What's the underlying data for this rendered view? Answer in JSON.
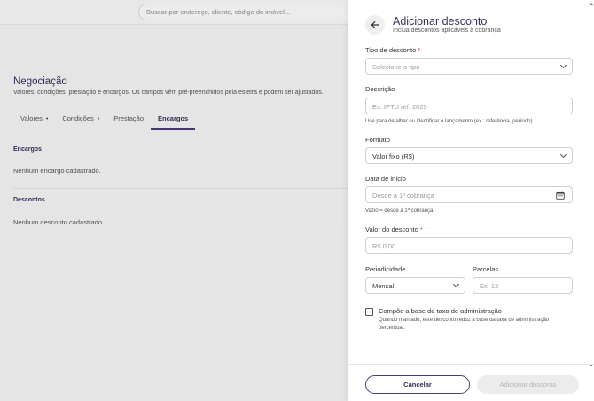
{
  "background": {
    "search_placeholder": "Buscar por endereço, cliente, código do imóvel...",
    "page_title": "Negociação",
    "page_subtitle": "Valores, condições, prestação e encargos. Os campos vêm pré-preenchidos pela esteira e podem ser ajustados.",
    "tabs": [
      {
        "label": "Valores",
        "marker": "•"
      },
      {
        "label": "Condições",
        "marker": "•"
      },
      {
        "label": "Prestação",
        "marker": ""
      },
      {
        "label": "Encargos",
        "marker": ""
      }
    ],
    "sections": {
      "encargos_title": "Encargos",
      "encargos_empty": "Nenhum encargo cadastrado.",
      "descontos_title": "Descontos",
      "descontos_empty": "Nenhum desconto cadastrado."
    }
  },
  "drawer": {
    "title": "Adicionar desconto",
    "subtitle": "Inclua descontos aplicáveis à cobrança",
    "tipo": {
      "label": "Tipo de desconto",
      "required": "*",
      "placeholder": "Selecione o tipo"
    },
    "descricao": {
      "label": "Descrição",
      "placeholder": "Ex: IPTU ref. 2025",
      "hint": "Use para detalhar ou identificar o lançamento (ex.: referência, período)."
    },
    "formato": {
      "label": "Formato",
      "value": "Valor fixo (R$)"
    },
    "data_inicio": {
      "label": "Data de início",
      "placeholder": "Desde a 1ª cobrança",
      "hint": "Vazio = desde a 1ª cobrança."
    },
    "valor": {
      "label": "Valor do desconto",
      "required": "*",
      "placeholder": "R$ 0,00"
    },
    "periodicidade": {
      "label": "Periodicidade",
      "value": "Mensal"
    },
    "parcelas": {
      "label": "Parcelas",
      "placeholder": "Ex: 12"
    },
    "checkbox": {
      "label": "Compõe a base da taxa de administração",
      "description": "Quando marcado, este desconto reduz a base da taxa de administração percentual."
    },
    "buttons": {
      "cancel": "Cancelar",
      "add": "Adicionar desconto"
    },
    "colors": {
      "accent": "#4b3a7a",
      "title": "#3a2d59",
      "required": "#d0463d"
    }
  }
}
